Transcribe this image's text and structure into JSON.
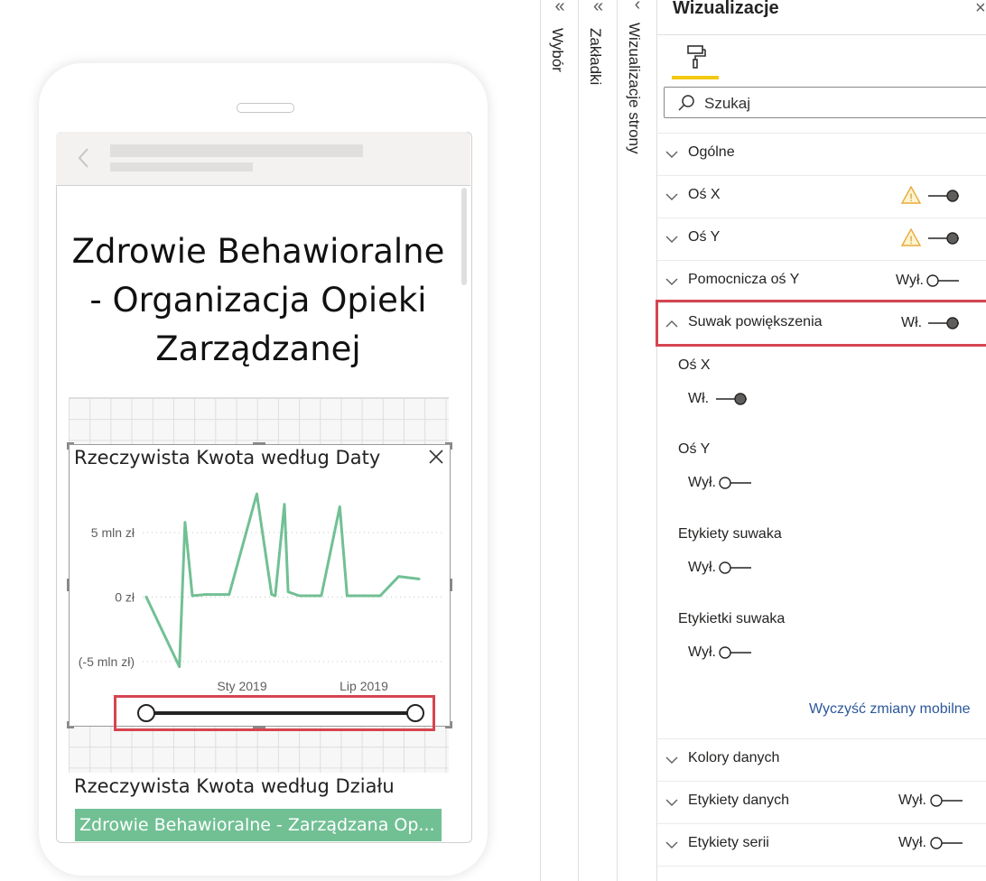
{
  "canvas": {
    "report_title": "Zdrowie Behawioralne - Organizacja Opieki Zarządzanej",
    "visual": {
      "title": "Rzeczywista Kwota według Daty"
    },
    "visual2": {
      "title": "Rzeczywista Kwota według Działu",
      "bar_label": "Zdrowie Behawioralne - Zarządzana Op..."
    }
  },
  "chart_data": {
    "type": "line",
    "title": "Rzeczywista Kwota według Daty",
    "y_ticks": [
      "5 mln zł",
      "0 zł",
      "(-5 mln zł)"
    ],
    "x_ticks": [
      "Sty 2019",
      "Lip 2019"
    ],
    "ylim": [
      -5.5,
      8.5
    ],
    "color": "#71c094",
    "series": [
      {
        "x": [
          0,
          1.8,
          2.1,
          2.5,
          3.2,
          4.5,
          6.0,
          6.8,
          7.0,
          7.5,
          7.7,
          8.3,
          9.5,
          10.5,
          10.9,
          11.6,
          12.7,
          13.7,
          14.8
        ],
        "values": [
          0,
          -5.4,
          5.8,
          0.1,
          0.2,
          0.2,
          8.0,
          0.2,
          0.1,
          7.2,
          0.4,
          0.1,
          0.1,
          7.0,
          0.1,
          0.1,
          0.1,
          1.6,
          1.4
        ]
      }
    ],
    "zoom_slider": {
      "start": 0.0,
      "end": 1.0
    }
  },
  "side_panes": {
    "selection": "Wybór",
    "bookmarks": "Zakładki",
    "page_visuals": "Wizualizacje strony"
  },
  "viz_pane": {
    "title": "Wizualizacje",
    "search_placeholder": "Szukaj",
    "sections": [
      {
        "label": "Ogólne"
      },
      {
        "label": "Oś X"
      },
      {
        "label": "Oś Y"
      },
      {
        "label": "Pomocnicza oś Y",
        "state": "Wył."
      },
      {
        "label": "Suwak powiększenia",
        "state": "Wł."
      }
    ],
    "zoom_options": [
      {
        "label": "Oś X",
        "state": "Wł."
      },
      {
        "label": "Oś Y",
        "state": "Wył."
      },
      {
        "label": "Etykiety suwaka",
        "state": "Wył."
      },
      {
        "label": "Etykietki suwaka",
        "state": "Wył."
      }
    ],
    "reset_link": "Wyczyść zmiany mobilne",
    "more_sections": [
      {
        "label": "Kolory danych"
      },
      {
        "label": "Etykiety danych",
        "state": "Wył."
      },
      {
        "label": "Etykiety serii",
        "state": "Wył."
      }
    ],
    "colors": {
      "accent_yellow": "#f2c811",
      "highlight_red": "#d64550",
      "link_blue": "#2b579a"
    }
  }
}
